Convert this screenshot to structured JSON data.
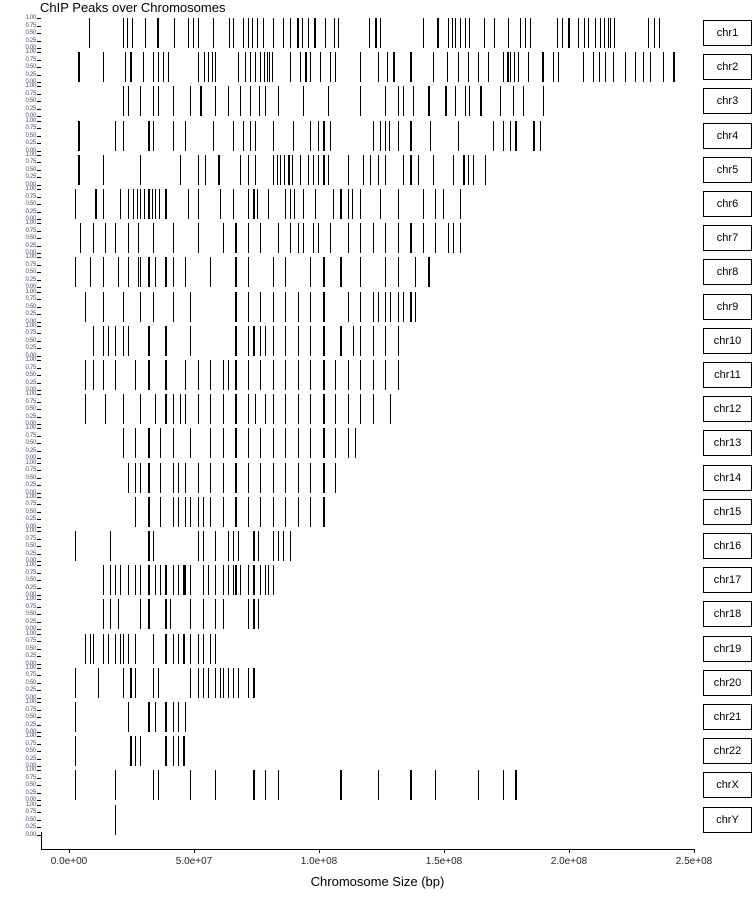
{
  "title": "ChIP Peaks over Chromosomes",
  "axes": {
    "x_title": "Chromosome Size (bp)",
    "x_ticks": [
      "0.0e+00",
      "5.0e+07",
      "1.0e+08",
      "1.5e+08",
      "2.0e+08",
      "2.5e+08"
    ],
    "x_tick_values": [
      0,
      50000000,
      100000000,
      150000000,
      200000000,
      250000000
    ],
    "y_ticks": [
      "1.00",
      "0.75",
      "0.50",
      "0.25",
      "0.00"
    ],
    "y_tick_values": [
      1.0,
      0.75,
      0.5,
      0.25,
      0.0
    ]
  },
  "colors": {
    "background": "#ffffff",
    "peak": "#000000",
    "axis_text": "#262626",
    "y_axis_text": "#4b4b6e",
    "strip_border": "#000000"
  },
  "chart_data": {
    "type": "rug",
    "title": "ChIP Peaks over Chromosomes",
    "xlabel": "Chromosome Size (bp)",
    "ylabel": "",
    "xlim": [
      0,
      255000000
    ],
    "ylim": [
      0,
      1
    ],
    "grid": false,
    "legend": "none",
    "facet_variable": "chromosome",
    "facet_labels": [
      "chr1",
      "chr2",
      "chr3",
      "chr4",
      "chr5",
      "chr6",
      "chr7",
      "chr8",
      "chr9",
      "chr10",
      "chr11",
      "chr12",
      "chr13",
      "chr14",
      "chr15",
      "chr16",
      "chr17",
      "chr18",
      "chr19",
      "chr20",
      "chr21",
      "chr22",
      "chrX",
      "chrY"
    ],
    "facet_strip_position": "right",
    "series": [
      {
        "name": "chr1",
        "peaks": [
          7800000,
          21500000,
          23200000,
          25000000,
          30500000,
          35000000,
          41800000,
          47500000,
          49500000,
          51500000,
          57500000,
          64000000,
          65500000,
          69500000,
          71500000,
          73000000,
          75000000,
          77500000,
          81500000,
          85500000,
          88500000,
          91000000,
          93000000,
          95500000,
          98000000,
          102500000,
          106000000,
          107500000,
          120000000,
          122500000,
          124500000,
          141500000,
          147000000,
          151500000,
          153000000,
          154500000,
          156500000,
          158500000,
          160000000,
          166000000,
          170000000,
          175500000,
          180500000,
          182500000,
          184500000,
          195000000,
          197000000,
          199500000,
          203500000,
          206000000,
          207500000,
          210500000,
          212500000,
          214000000,
          215500000,
          216500000,
          218000000,
          231500000,
          234000000,
          236000000
        ]
      },
      {
        "name": "chr2",
        "peaks": [
          3500000,
          13500000,
          22500000,
          24500000,
          29500000,
          33500000,
          35500000,
          37500000,
          39500000,
          51500000,
          54000000,
          55500000,
          57000000,
          58500000,
          67500000,
          70500000,
          72500000,
          74500000,
          76500000,
          78000000,
          79000000,
          80000000,
          81000000,
          88500000,
          92500000,
          94500000,
          96500000,
          100500000,
          104500000,
          106500000,
          116500000,
          123500000,
          127000000,
          129500000,
          136500000,
          145500000,
          151000000,
          155500000,
          159500000,
          163500000,
          167500000,
          173500000,
          175000000,
          176500000,
          178000000,
          179500000,
          183500000,
          189000000,
          193500000,
          195500000,
          205500000,
          209500000,
          212000000,
          214500000,
          217500000,
          222500000,
          226500000,
          229500000,
          232500000,
          237500000,
          241500000
        ]
      },
      {
        "name": "chr3",
        "peaks": [
          21500000,
          23500000,
          28500000,
          33500000,
          35500000,
          41500000,
          48500000,
          52500000,
          58500000,
          63500000,
          68500000,
          72500000,
          76000000,
          78500000,
          83500000,
          93500000,
          103500000,
          116500000,
          126500000,
          131500000,
          133500000,
          137500000,
          143500000,
          150500000,
          154500000,
          158500000,
          160000000,
          164500000,
          172500000,
          177500000,
          181500000,
          189500000
        ]
      },
      {
        "name": "chr4",
        "peaks": [
          3500000,
          18500000,
          21500000,
          31500000,
          33500000,
          41500000,
          46500000,
          57500000,
          65500000,
          69500000,
          72500000,
          74500000,
          81500000,
          89500000,
          96500000,
          99500000,
          101500000,
          104500000,
          121500000,
          124500000,
          126500000,
          128000000,
          131500000,
          136500000,
          144500000,
          155500000,
          169500000,
          173500000,
          176500000,
          178500000,
          185500000,
          188500000
        ]
      },
      {
        "name": "chr5",
        "peaks": [
          3500000,
          13500000,
          28500000,
          44500000,
          51500000,
          54500000,
          59500000,
          68500000,
          71500000,
          74500000,
          81500000,
          83000000,
          84500000,
          86000000,
          87500000,
          89000000,
          92500000,
          95500000,
          97500000,
          99500000,
          101500000,
          103500000,
          111500000,
          117500000,
          120500000,
          123500000,
          126500000,
          133500000,
          136500000,
          139500000,
          145500000,
          153500000,
          157500000,
          159500000,
          161500000,
          166500000
        ]
      },
      {
        "name": "chr6",
        "peaks": [
          2500000,
          10500000,
          13500000,
          20500000,
          23500000,
          25500000,
          27000000,
          28500000,
          30000000,
          31500000,
          33000000,
          34500000,
          36000000,
          38500000,
          47500000,
          51500000,
          60500000,
          65500000,
          71500000,
          73500000,
          75000000,
          79500000,
          86500000,
          88500000,
          90000000,
          93500000,
          98500000,
          105500000,
          108500000,
          111500000,
          113000000,
          116500000,
          124500000,
          131500000,
          141500000,
          146500000,
          149500000,
          156500000
        ]
      },
      {
        "name": "chr7",
        "peaks": [
          4500000,
          9500000,
          14500000,
          18500000,
          23500000,
          27500000,
          33500000,
          41500000,
          51500000,
          61500000,
          66500000,
          71500000,
          76500000,
          83500000,
          88500000,
          91500000,
          93500000,
          97500000,
          99500000,
          104500000,
          111500000,
          116500000,
          121500000,
          126500000,
          131500000,
          136500000,
          141500000,
          146500000,
          151500000,
          153500000,
          156500000
        ]
      },
      {
        "name": "chr8",
        "peaks": [
          2500000,
          8500000,
          13500000,
          19500000,
          23500000,
          27500000,
          28500000,
          31500000,
          34500000,
          38500000,
          41500000,
          46500000,
          56500000,
          66500000,
          71500000,
          81500000,
          86500000,
          96500000,
          101500000,
          108500000,
          116500000,
          126500000,
          131500000,
          138500000,
          143500000
        ]
      },
      {
        "name": "chr9",
        "peaks": [
          6500000,
          13500000,
          21500000,
          28500000,
          33500000,
          41500000,
          48500000,
          66500000,
          71500000,
          76500000,
          81500000,
          86500000,
          91500000,
          96500000,
          101500000,
          111500000,
          116500000,
          121500000,
          123500000,
          126500000,
          128500000,
          131500000,
          133500000,
          136500000,
          138500000
        ]
      },
      {
        "name": "chr10",
        "peaks": [
          9500000,
          13500000,
          15500000,
          18500000,
          21500000,
          23500000,
          31500000,
          38500000,
          48500000,
          66500000,
          71500000,
          73500000,
          76500000,
          78500000,
          81500000,
          86500000,
          91500000,
          96500000,
          101500000,
          108500000,
          113500000,
          116500000,
          121500000,
          126500000,
          131500000
        ]
      },
      {
        "name": "chr11",
        "peaks": [
          6500000,
          9500000,
          13500000,
          18500000,
          26500000,
          31500000,
          38500000,
          46500000,
          51500000,
          56500000,
          61500000,
          63500000,
          66500000,
          71500000,
          76500000,
          81500000,
          86500000,
          91500000,
          96500000,
          101500000,
          106500000,
          111500000,
          116500000,
          121500000,
          126500000,
          131500000
        ]
      },
      {
        "name": "chr12",
        "peaks": [
          6500000,
          14500000,
          21500000,
          28500000,
          34500000,
          38500000,
          41500000,
          44500000,
          46500000,
          51500000,
          56500000,
          61500000,
          66500000,
          71500000,
          74500000,
          78500000,
          81500000,
          86500000,
          91500000,
          96500000,
          101500000,
          106500000,
          111500000,
          116500000,
          121500000,
          128500000
        ]
      },
      {
        "name": "chr13",
        "peaks": [
          21500000,
          26500000,
          31500000,
          36500000,
          41500000,
          48500000,
          56500000,
          61500000,
          66500000,
          71500000,
          76500000,
          81500000,
          86500000,
          91500000,
          96500000,
          101500000,
          106500000,
          111500000,
          114500000
        ]
      },
      {
        "name": "chr14",
        "peaks": [
          23500000,
          26500000,
          28500000,
          31500000,
          36500000,
          41500000,
          43500000,
          46500000,
          51500000,
          56500000,
          61500000,
          66500000,
          71500000,
          76500000,
          81500000,
          86500000,
          91500000,
          96500000,
          101500000,
          106500000
        ]
      },
      {
        "name": "chr15",
        "peaks": [
          26500000,
          31500000,
          36500000,
          41500000,
          43500000,
          46500000,
          48500000,
          51500000,
          53500000,
          56500000,
          61500000,
          66500000,
          71500000,
          76500000,
          81500000,
          86500000,
          91500000,
          96500000,
          101500000
        ]
      },
      {
        "name": "chr16",
        "peaks": [
          2500000,
          16500000,
          31500000,
          33500000,
          51500000,
          53500000,
          58500000,
          63500000,
          65500000,
          67500000,
          73500000,
          75500000,
          81500000,
          83500000,
          85500000,
          88500000
        ]
      },
      {
        "name": "chr17",
        "peaks": [
          13500000,
          16500000,
          18500000,
          20500000,
          23500000,
          26500000,
          28500000,
          31500000,
          34500000,
          36500000,
          38500000,
          41500000,
          43500000,
          45500000,
          46500000,
          48500000,
          53500000,
          55500000,
          58500000,
          61500000,
          63500000,
          65500000,
          66500000,
          68500000,
          71500000,
          73500000,
          76500000,
          78500000,
          79500000,
          81500000
        ]
      },
      {
        "name": "chr18",
        "peaks": [
          13500000,
          16500000,
          19500000,
          28500000,
          31500000,
          38500000,
          40500000,
          48500000,
          53500000,
          58500000,
          61500000,
          71500000,
          73500000,
          75500000
        ]
      },
      {
        "name": "chr19",
        "peaks": [
          6500000,
          8500000,
          9500000,
          13500000,
          15500000,
          18500000,
          20500000,
          21500000,
          23500000,
          26500000,
          33500000,
          38500000,
          41500000,
          43500000,
          45500000,
          48500000,
          51500000,
          53500000,
          56500000,
          58500000
        ]
      },
      {
        "name": "chr20",
        "peaks": [
          2500000,
          11500000,
          21500000,
          24500000,
          26500000,
          33500000,
          35500000,
          48500000,
          51500000,
          53500000,
          55500000,
          58500000,
          60500000,
          61500000,
          63500000,
          65500000,
          67500000,
          71500000,
          73500000
        ]
      },
      {
        "name": "chr21",
        "peaks": [
          2500000,
          23500000,
          31500000,
          34500000,
          38500000,
          41500000,
          43500000,
          46500000
        ]
      },
      {
        "name": "chr22",
        "peaks": [
          2500000,
          24500000,
          26500000,
          28500000,
          38500000,
          41500000,
          43500000,
          45500000
        ]
      },
      {
        "name": "chrX",
        "peaks": [
          2500000,
          18500000,
          33500000,
          35500000,
          48500000,
          58500000,
          73500000,
          78500000,
          83500000,
          108500000,
          123500000,
          136500000,
          146500000,
          163500000,
          173500000,
          178500000
        ]
      },
      {
        "name": "chrY",
        "peaks": [
          18500000
        ]
      }
    ]
  }
}
